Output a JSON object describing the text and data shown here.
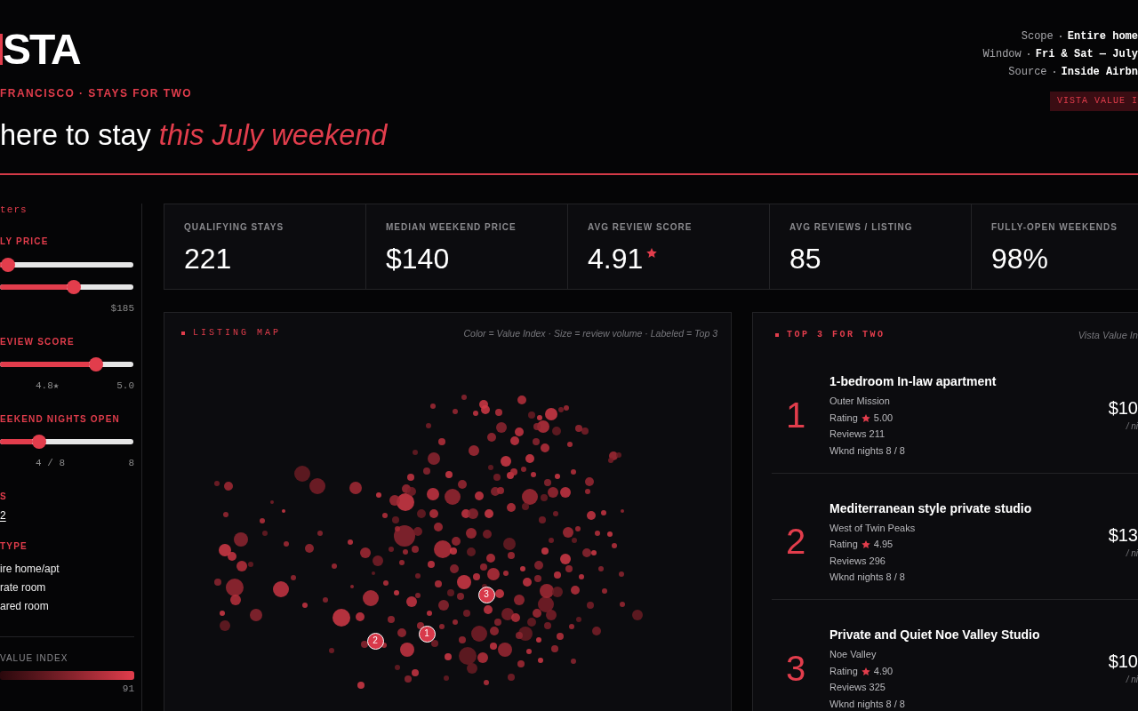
{
  "header": {
    "logo": "STA",
    "subtitle": "FRANCISCO · STAYS FOR TWO",
    "headline": "here to stay *this July weekend*"
  },
  "meta": [
    {
      "label": "Scope",
      "value": "Entire home"
    },
    {
      "label": "Window",
      "value": "Fri & Sat — July"
    },
    {
      "label": "Source",
      "value": "Inside Airbn"
    }
  ],
  "badge": "VISTA VALUE I",
  "sidebar": {
    "title": "ters",
    "filters": [
      {
        "kind": "range",
        "label": "LY PRICE",
        "sliders": [
          {
            "level": 0.06
          },
          {
            "level": 0.55
          }
        ],
        "end_reading": "$185"
      },
      {
        "kind": "slider",
        "label": "EVIEW SCORE",
        "level": 0.72,
        "value_reading": "4.8★",
        "end_reading": "5.0"
      },
      {
        "kind": "slider",
        "label": "EEKEND NIGHTS OPEN",
        "level": 0.29,
        "value_reading": "4 / 8",
        "end_reading": "8"
      },
      {
        "kind": "value",
        "label": "S",
        "value": "2"
      },
      {
        "kind": "options",
        "label": "TYPE",
        "options": [
          "ire home/apt",
          "rate room",
          "ared room"
        ]
      }
    ],
    "legend": {
      "label": "VALUE INDEX",
      "max": "91"
    }
  },
  "kpis": [
    {
      "kind": "number",
      "label": "QUALIFYING STAYS",
      "value": "221"
    },
    {
      "kind": "number",
      "label": "MEDIAN WEEKEND PRICE",
      "value": "$140"
    },
    {
      "kind": "rating",
      "label": "AVG REVIEW SCORE",
      "value": "4.91"
    },
    {
      "kind": "number",
      "label": "AVG REVIEWS / LISTING",
      "value": "85"
    },
    {
      "kind": "number",
      "label": "FULLY-OPEN WEEKENDS",
      "value": "98%"
    }
  ],
  "map": {
    "title": "LISTING MAP",
    "note": "Color = Value Index · Size = review volume · Labeled = Top 3",
    "markers": [
      {
        "label": "1"
      },
      {
        "label": "2"
      },
      {
        "label": "3"
      }
    ]
  },
  "top": {
    "title": "TOP 3 FOR TWO",
    "note": "Vista Value In",
    "listings": [
      {
        "rank": "1",
        "name": "1-bedroom In-law apartment",
        "area": "Outer Mission",
        "rating_label": "Rating",
        "rating": "5.00",
        "reviews": "Reviews 211",
        "nights": "Wknd nights 8 / 8",
        "price": "$10",
        "unit": "/ ni"
      },
      {
        "rank": "2",
        "name": "Mediterranean style private studio",
        "area": "West of Twin Peaks",
        "rating_label": "Rating",
        "rating": "4.95",
        "reviews": "Reviews 296",
        "nights": "Wknd nights 8 / 8",
        "price": "$13",
        "unit": "/ ni"
      },
      {
        "rank": "3",
        "name": "Private and Quiet Noe Valley Studio",
        "area": "Noe Valley",
        "rating_label": "Rating",
        "rating": "4.90",
        "reviews": "Reviews 325",
        "nights": "Wknd nights 8 / 8",
        "price": "$10",
        "unit": "/ ni"
      }
    ]
  }
}
